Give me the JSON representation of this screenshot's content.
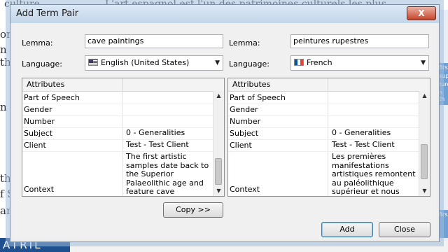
{
  "background": {
    "top_text": "L'art espagnol est l'un des patrimoines culturels les plus",
    "top_text_left": "culture",
    "left_fragments": [
      "on",
      "n th",
      "n t",
      "th",
      "f S",
      "ar"
    ],
    "right_fragments": [
      "first",
      "sup",
      "ture",
      "n th",
      "firs"
    ],
    "close_glyph": "X",
    "brand": "ATRIL"
  },
  "dialog": {
    "title": "Add Term Pair",
    "close_glyph": "X",
    "source": {
      "lemma_label": "Lemma:",
      "lemma_value": "cave paintings",
      "language_label": "Language:",
      "language_value": "English (United States)",
      "flag_icon": "us-flag-icon",
      "grid_header": "Attributes",
      "rows": [
        {
          "key": "Part of Speech",
          "value": ""
        },
        {
          "key": "Gender",
          "value": ""
        },
        {
          "key": "Number",
          "value": ""
        },
        {
          "key": "Subject",
          "value": "0 - Generalities"
        },
        {
          "key": "Client",
          "value": "Test - Test Client"
        },
        {
          "key": "Context",
          "value": "The first artistic samples date back to the Superior Palaeolithic age and feature cave paintings from the"
        }
      ]
    },
    "target": {
      "lemma_label": "Lemma:",
      "lemma_value": "peintures rupestres",
      "language_label": "Language:",
      "language_value": "French",
      "flag_icon": "fr-flag-icon",
      "grid_header": "Attributes",
      "rows": [
        {
          "key": "Part of Speech",
          "value": ""
        },
        {
          "key": "Gender",
          "value": ""
        },
        {
          "key": "Number",
          "value": ""
        },
        {
          "key": "Subject",
          "value": "0 - Generalities"
        },
        {
          "key": "Client",
          "value": "Test - Test Client"
        },
        {
          "key": "Context",
          "value": "Les premières manifestations artistiques remontent au paléolithique supérieur et nous pouvons citer"
        }
      ]
    },
    "copy_label": "Copy >>",
    "add_label": "Add",
    "close_label": "Close"
  }
}
